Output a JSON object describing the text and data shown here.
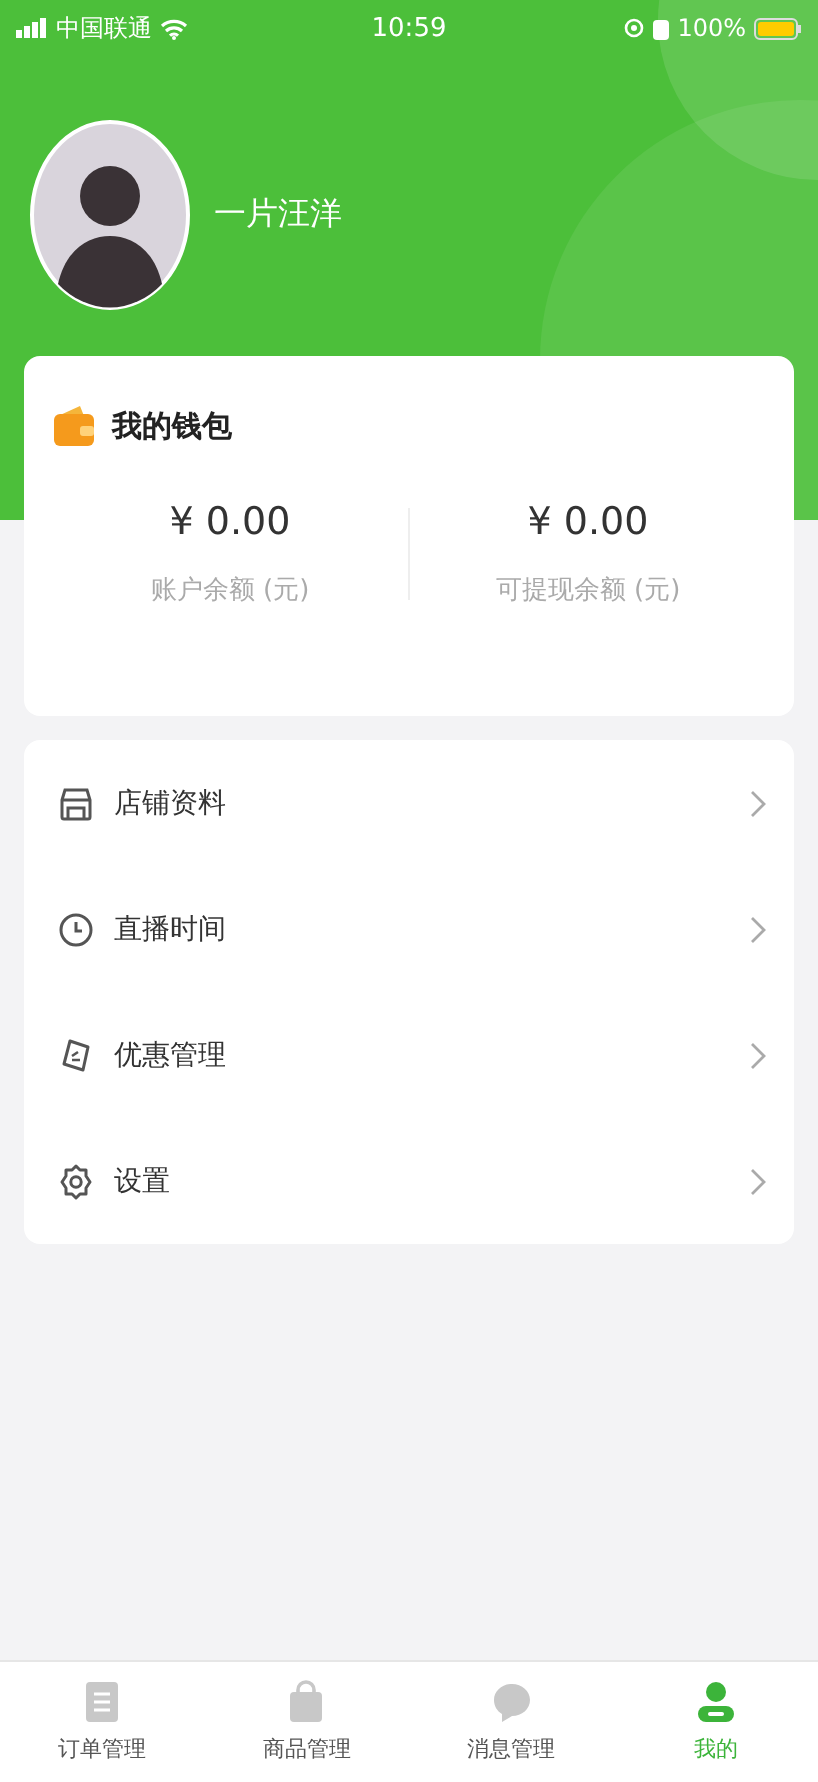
{
  "status_bar": {
    "carrier": "中国联通",
    "time": "10:59",
    "battery": "100%"
  },
  "profile": {
    "username": "一片汪洋"
  },
  "wallet": {
    "title": "我的钱包",
    "balances": [
      {
        "amount": "¥ 0.00",
        "label": "账户余额 (元)"
      },
      {
        "amount": "¥ 0.00",
        "label": "可提现余额 (元)"
      }
    ]
  },
  "menu": [
    {
      "kind": "store",
      "label": "店铺资料"
    },
    {
      "kind": "clock",
      "label": "直播时间"
    },
    {
      "kind": "coupon",
      "label": "优惠管理"
    },
    {
      "kind": "settings",
      "label": "设置"
    }
  ],
  "tab_bar": [
    {
      "kind": "orders",
      "label": "订单管理",
      "selected": false
    },
    {
      "kind": "goods",
      "label": "商品管理",
      "selected": false
    },
    {
      "kind": "messages",
      "label": "消息管理",
      "selected": false
    },
    {
      "kind": "me",
      "label": "我的",
      "selected": true
    }
  ]
}
